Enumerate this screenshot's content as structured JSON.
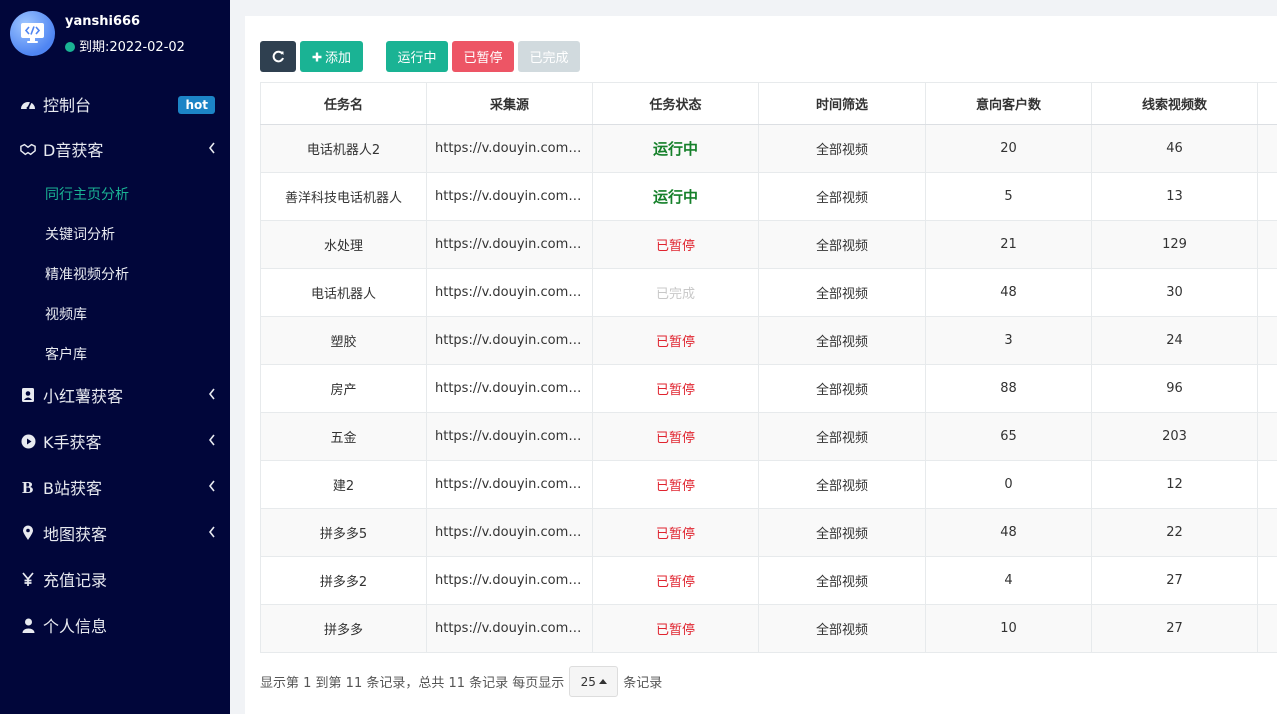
{
  "user": {
    "name": "yanshi666",
    "expire": "到期:2022-02-02"
  },
  "sidebar": {
    "dashboard": {
      "label": "控制台",
      "badge": "hot"
    },
    "douyin": {
      "label": "D音获客",
      "children": [
        "同行主页分析",
        "关键词分析",
        "精准视频分析",
        "视频库",
        "客户库"
      ]
    },
    "xiaohongshu": "小红薯获客",
    "kuaishou": "K手获客",
    "bilibili": "B站获客",
    "map": "地图获客",
    "recharge": "充值记录",
    "profile": "个人信息"
  },
  "toolbar": {
    "add": "添加",
    "running": "运行中",
    "paused": "已暂停",
    "done": "已完成"
  },
  "table": {
    "headers": [
      "任务名",
      "采集源",
      "任务状态",
      "时间筛选",
      "意向客户数",
      "线索视频数"
    ],
    "rows": [
      {
        "name": "电话机器人2",
        "source": "https://v.douyin.com/R...",
        "status": "运行中",
        "filter": "全部视频",
        "customers": "20",
        "videos": "46"
      },
      {
        "name": "善洋科技电话机器人",
        "source": "https://v.douyin.com/R...",
        "status": "运行中",
        "filter": "全部视频",
        "customers": "5",
        "videos": "13"
      },
      {
        "name": "水处理",
        "source": "https://v.douyin.com/R...",
        "status": "已暂停",
        "filter": "全部视频",
        "customers": "21",
        "videos": "129"
      },
      {
        "name": "电话机器人",
        "source": "https://v.douyin.com/R...",
        "status": "已完成",
        "filter": "全部视频",
        "customers": "48",
        "videos": "30"
      },
      {
        "name": "塑胶",
        "source": "https://v.douyin.com/R...",
        "status": "已暂停",
        "filter": "全部视频",
        "customers": "3",
        "videos": "24"
      },
      {
        "name": "房产",
        "source": "https://v.douyin.com/Rv...",
        "status": "已暂停",
        "filter": "全部视频",
        "customers": "88",
        "videos": "96"
      },
      {
        "name": "五金",
        "source": "https://v.douyin.com/Rp...",
        "status": "已暂停",
        "filter": "全部视频",
        "customers": "65",
        "videos": "203"
      },
      {
        "name": "建2",
        "source": "https://v.douyin.com/Rp...",
        "status": "已暂停",
        "filter": "全部视频",
        "customers": "0",
        "videos": "12"
      },
      {
        "name": "拼多多5",
        "source": "https://v.douyin.com/Rp...",
        "status": "已暂停",
        "filter": "全部视频",
        "customers": "48",
        "videos": "22"
      },
      {
        "name": "拼多多2",
        "source": "https://v.douyin.com/Rp...",
        "status": "已暂停",
        "filter": "全部视频",
        "customers": "4",
        "videos": "27"
      },
      {
        "name": "拼多多",
        "source": "https://v.douyin.com/Rp...",
        "status": "已暂停",
        "filter": "全部视频",
        "customers": "10",
        "videos": "27"
      }
    ]
  },
  "pagination": {
    "summary": "显示第 1 到第 11 条记录，总共 11 条记录 每页显示",
    "page_size": "25",
    "suffix": "条记录"
  },
  "colors": {
    "sidebar_bg": "#01063a",
    "accent": "#1ab394",
    "danger": "#ed5565",
    "running_text": "#15802a",
    "paused_text": "#e0242f"
  }
}
